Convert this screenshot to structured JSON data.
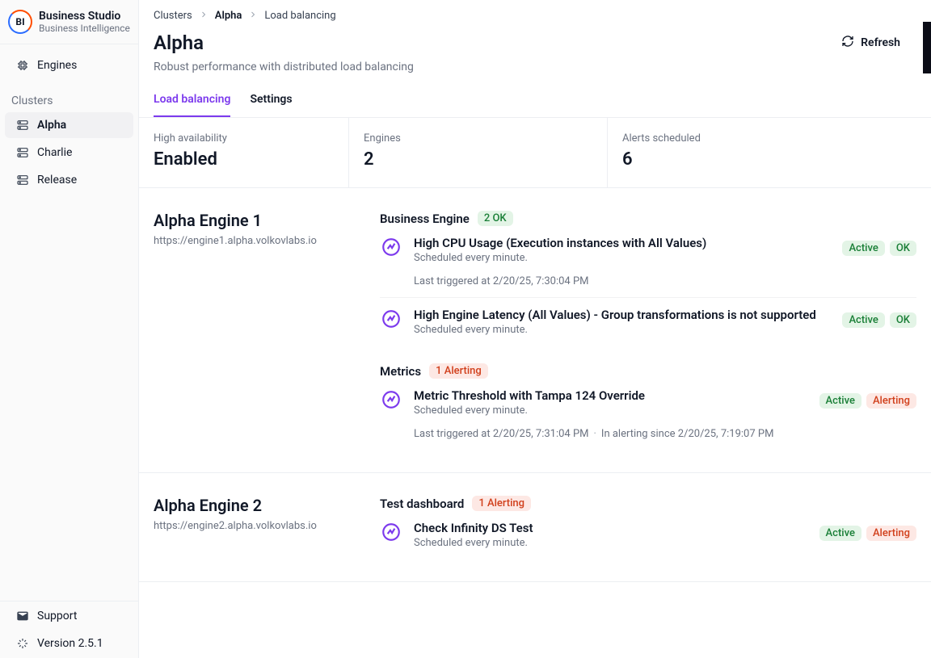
{
  "brand": {
    "title": "Business Studio",
    "subtitle": "Business Intelligence",
    "logo_text": "BI"
  },
  "sidebar": {
    "engines_label": "Engines",
    "clusters_heading": "Clusters",
    "clusters": [
      {
        "label": "Alpha",
        "active": true
      },
      {
        "label": "Charlie",
        "active": false
      },
      {
        "label": "Release",
        "active": false
      }
    ],
    "support_label": "Support",
    "version_label": "Version 2.5.1"
  },
  "crumbs": {
    "root": "Clusters",
    "cluster": "Alpha",
    "page": "Load balancing"
  },
  "header": {
    "title": "Alpha",
    "subtitle": "Robust performance with distributed load balancing",
    "refresh": "Refresh"
  },
  "tabs": [
    {
      "label": "Load balancing",
      "active": true
    },
    {
      "label": "Settings",
      "active": false
    }
  ],
  "stats": {
    "ha": {
      "label": "High availability",
      "value": "Enabled"
    },
    "engines": {
      "label": "Engines",
      "value": "2"
    },
    "alerts": {
      "label": "Alerts scheduled",
      "value": "6"
    }
  },
  "engines": [
    {
      "name": "Alpha Engine 1",
      "url": "https://engine1.alpha.volkovlabs.io",
      "groups": [
        {
          "title": "Business Engine",
          "badge": {
            "text": "2 OK",
            "kind": "green"
          },
          "alerts": [
            {
              "title": "High CPU Usage (Execution instances with All Values)",
              "schedule": "Scheduled every minute.",
              "last_triggered": "Last triggered at 2/20/25, 7:30:04 PM",
              "state": {
                "text": "Active",
                "kind": "green"
              },
              "status": {
                "text": "OK",
                "kind": "green"
              }
            },
            {
              "title": "High Engine Latency (All Values) - Group transformations is not supported",
              "schedule": "Scheduled every minute.",
              "last_triggered": "",
              "state": {
                "text": "Active",
                "kind": "green"
              },
              "status": {
                "text": "OK",
                "kind": "green"
              }
            }
          ]
        },
        {
          "title": "Metrics",
          "badge": {
            "text": "1 Alerting",
            "kind": "red"
          },
          "alerts": [
            {
              "title": "Metric Threshold with Tampa 124 Override",
              "schedule": "Scheduled every minute.",
              "last_triggered": "Last triggered at 2/20/25, 7:31:04 PM",
              "alerting_since": "In alerting since 2/20/25, 7:19:07 PM",
              "state": {
                "text": "Active",
                "kind": "green"
              },
              "status": {
                "text": "Alerting",
                "kind": "red"
              }
            }
          ]
        }
      ]
    },
    {
      "name": "Alpha Engine 2",
      "url": "https://engine2.alpha.volkovlabs.io",
      "groups": [
        {
          "title": "Test dashboard",
          "badge": {
            "text": "1 Alerting",
            "kind": "red"
          },
          "alerts": [
            {
              "title": "Check Infinity DS Test",
              "schedule": "Scheduled every minute.",
              "last_triggered": "",
              "state": {
                "text": "Active",
                "kind": "green"
              },
              "status": {
                "text": "Alerting",
                "kind": "red"
              }
            }
          ]
        }
      ]
    }
  ]
}
